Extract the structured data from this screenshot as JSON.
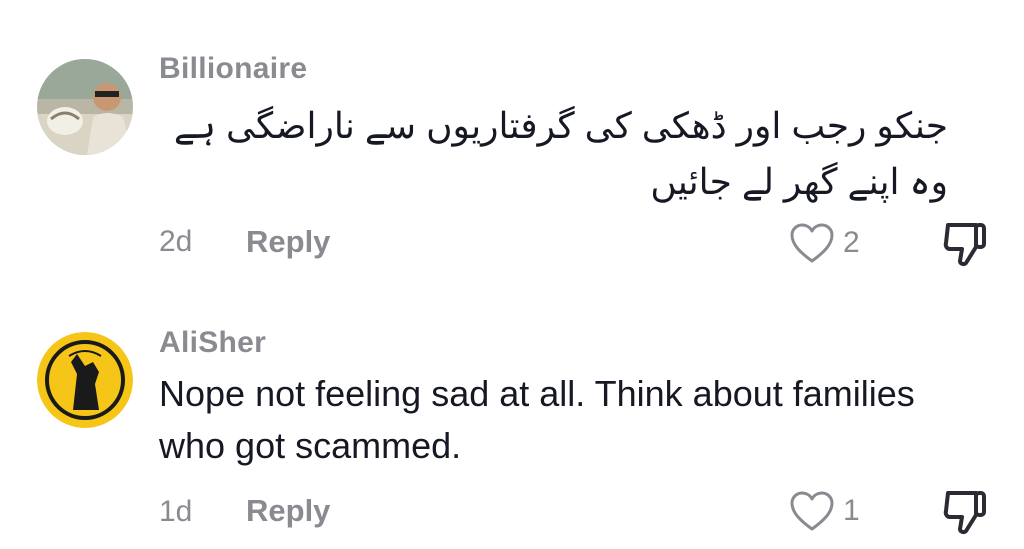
{
  "comments": [
    {
      "username": "Billionaire",
      "text": "جنکو رجب اور ڈھکی کی گرفتاریوں سے ناراضگی ہے وہ اپنے گھر لے جائیں",
      "age": "2d",
      "reply_label": "Reply",
      "likes": "2",
      "avatar_icon": "profile-photo"
    },
    {
      "username": "AliSher",
      "text": "Nope not feeling sad at all. Think about families who got scammed.",
      "age": "1d",
      "reply_label": "Reply",
      "likes": "1",
      "avatar_icon": "dog-silhouette-logo"
    }
  ],
  "colors": {
    "secondary_text": "#8a8b91",
    "primary_text": "#161823",
    "logo_yellow": "#f5c518"
  }
}
